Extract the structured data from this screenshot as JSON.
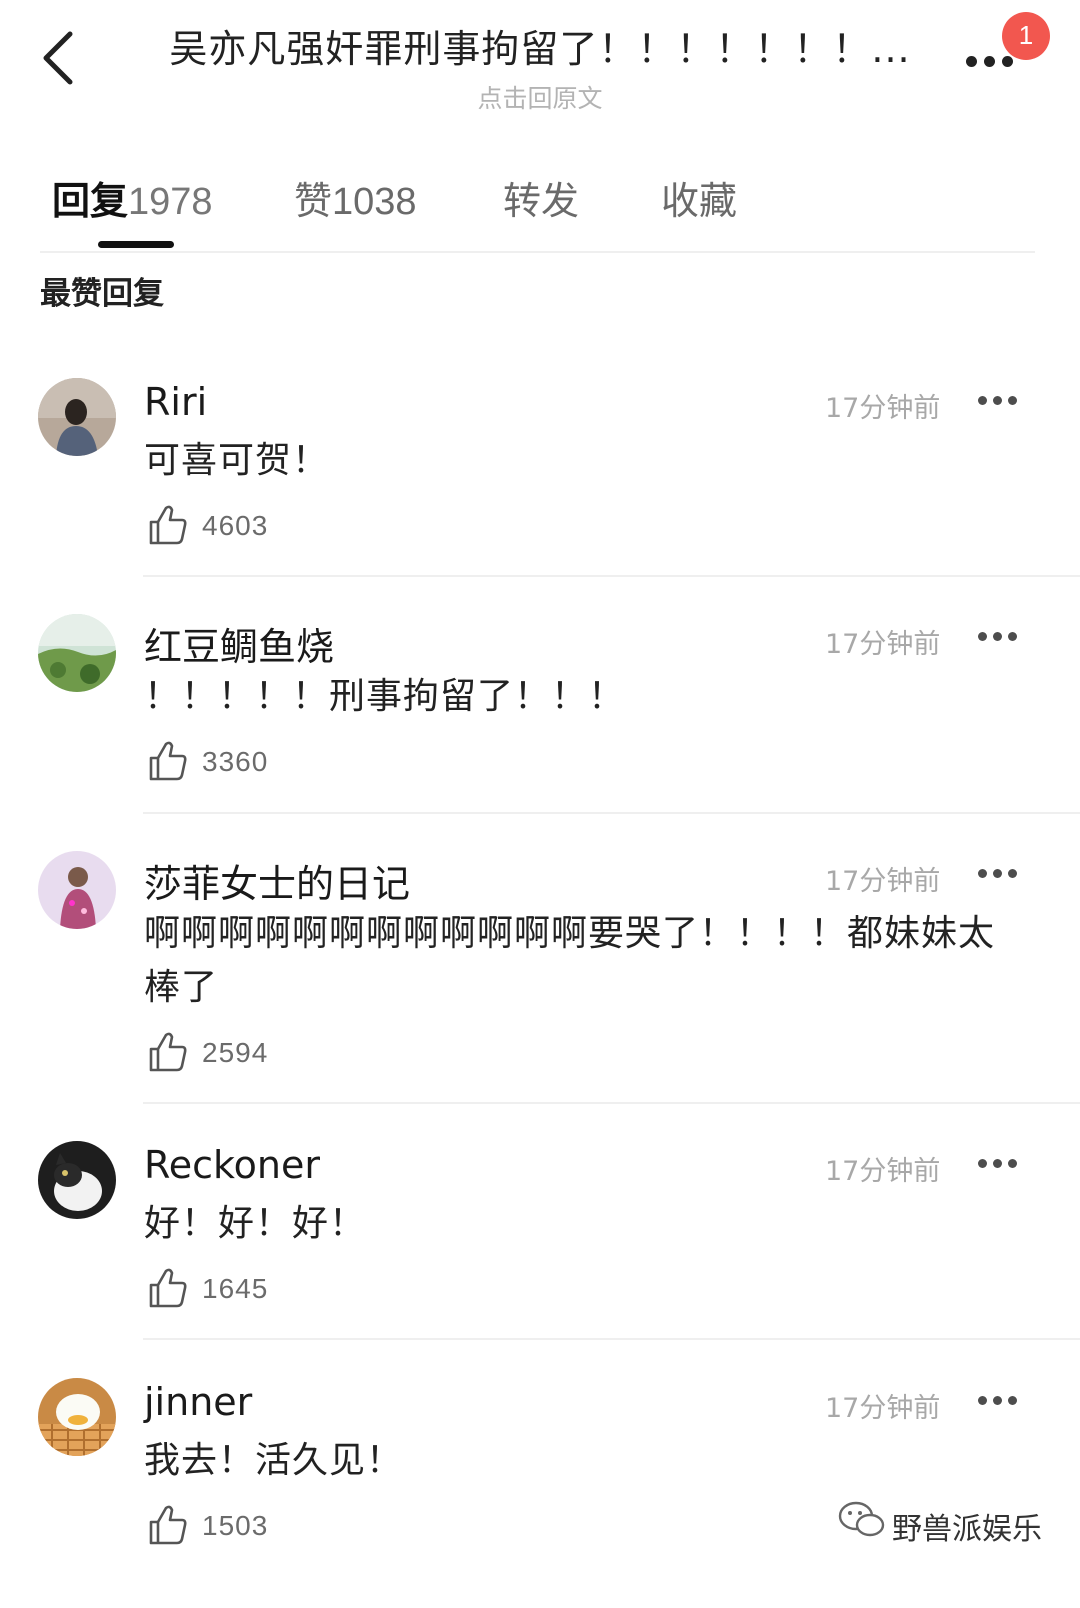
{
  "header": {
    "title": "吴亦凡强奸罪刑事拘留了！！！！！！！...",
    "subtitle": "点击回原文",
    "badge_count": "1"
  },
  "tabs": [
    {
      "label": "回复",
      "count": "1978",
      "active": true
    },
    {
      "label": "赞",
      "count": "1038",
      "active": false
    },
    {
      "label": "转发",
      "count": "",
      "active": false
    },
    {
      "label": "收藏",
      "count": "",
      "active": false
    }
  ],
  "section_title": "最赞回复",
  "comments": [
    {
      "username": "Riri",
      "time": "17分钟前",
      "content": "可喜可贺！",
      "likes": "4603"
    },
    {
      "username": "红豆鲷鱼烧",
      "time": "17分钟前",
      "content": "！！！！！刑事拘留了！！！",
      "likes": "3360"
    },
    {
      "username": "莎菲女士的日记",
      "time": "17分钟前",
      "content": "啊啊啊啊啊啊啊啊啊啊啊啊要哭了！！！！都妹妹太棒了",
      "likes": "2594"
    },
    {
      "username": "Reckoner",
      "time": "17分钟前",
      "content": "好！好！好！",
      "likes": "1645"
    },
    {
      "username": "jinner",
      "time": "17分钟前",
      "content": "我去！活久见！",
      "likes": "1503"
    }
  ],
  "watermark": "野兽派娱乐",
  "colors": {
    "badge": "#f2574f",
    "text_primary": "#222222",
    "text_secondary": "#a8a8a8",
    "divider": "#efefef"
  }
}
